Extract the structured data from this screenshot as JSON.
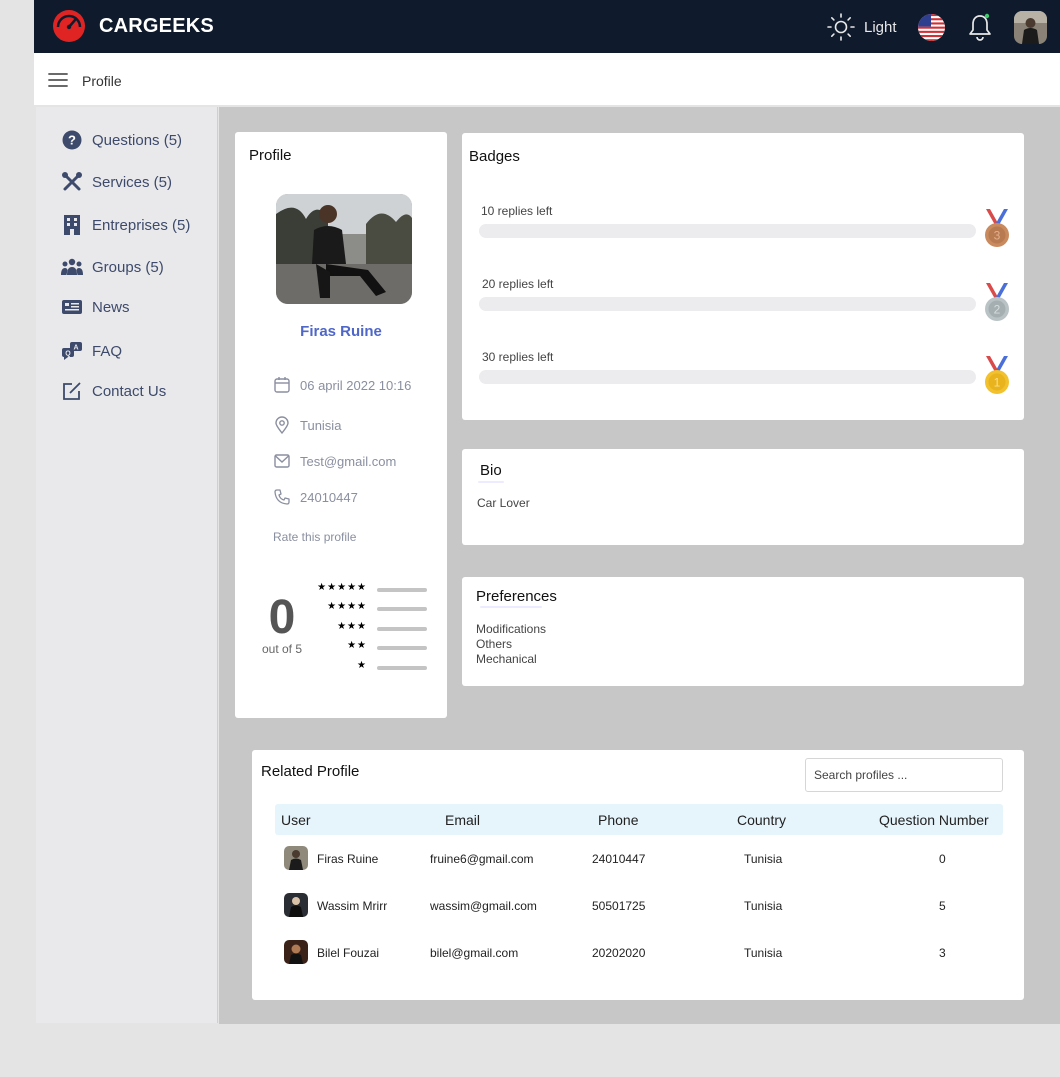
{
  "app": {
    "brand": "CARGEEKS",
    "theme_label": "Light"
  },
  "subheader": {
    "title": "Profile"
  },
  "sidebar": {
    "items": [
      {
        "label": "Questions (5)",
        "icon": "question-circle-icon"
      },
      {
        "label": "Services (5)",
        "icon": "tools-icon"
      },
      {
        "label": "Entreprises (5)",
        "icon": "building-icon"
      },
      {
        "label": "Groups (5)",
        "icon": "group-icon"
      },
      {
        "label": "News",
        "icon": "newspaper-icon"
      },
      {
        "label": "FAQ",
        "icon": "faq-chat-icon"
      },
      {
        "label": "Contact Us",
        "icon": "edit-square-icon"
      }
    ]
  },
  "profile": {
    "title": "Profile",
    "name": "Firas Ruine",
    "date": "06 april 2022 10:16",
    "location": "Tunisia",
    "email": "Test@gmail.com",
    "phone": "24010447",
    "rate_link": "Rate this profile",
    "score": "0",
    "score_sub": "out of 5",
    "star_rows": [
      "★★★★★",
      "★★★★",
      "★★★",
      "★★",
      "★"
    ]
  },
  "badges": {
    "title": "Badges",
    "items": [
      {
        "label": "10 replies left",
        "progress": 0,
        "medal": "3",
        "color": "#c98a5e"
      },
      {
        "label": "20 replies left",
        "progress": 0,
        "medal": "2",
        "color": "#b9c2c4"
      },
      {
        "label": "30 replies left",
        "progress": 0,
        "medal": "1",
        "color": "#f2c12e"
      }
    ]
  },
  "bio": {
    "title": "Bio",
    "text": "Car Lover"
  },
  "preferences": {
    "title": "Preferences",
    "items": [
      "Modifications",
      "Others",
      "Mechanical"
    ]
  },
  "related": {
    "title": "Related Profile",
    "search_placeholder": "Search profiles ...",
    "columns": [
      "User",
      "Email",
      "Phone",
      "Country",
      "Question Number"
    ],
    "rows": [
      {
        "user": "Firas Ruine",
        "email": "fruine6@gmail.com",
        "phone": "24010447",
        "country": "Tunisia",
        "questions": "0"
      },
      {
        "user": "Wassim Mrirr",
        "email": "wassim@gmail.com",
        "phone": "50501725",
        "country": "Tunisia",
        "questions": "5"
      },
      {
        "user": "Bilel Fouzai",
        "email": "bilel@gmail.com",
        "phone": "20202020",
        "country": "Tunisia",
        "questions": "3"
      }
    ]
  },
  "colors": {
    "topbar": "#0f1b2d",
    "accent": "#4f67c8",
    "logo": "#e02424"
  }
}
